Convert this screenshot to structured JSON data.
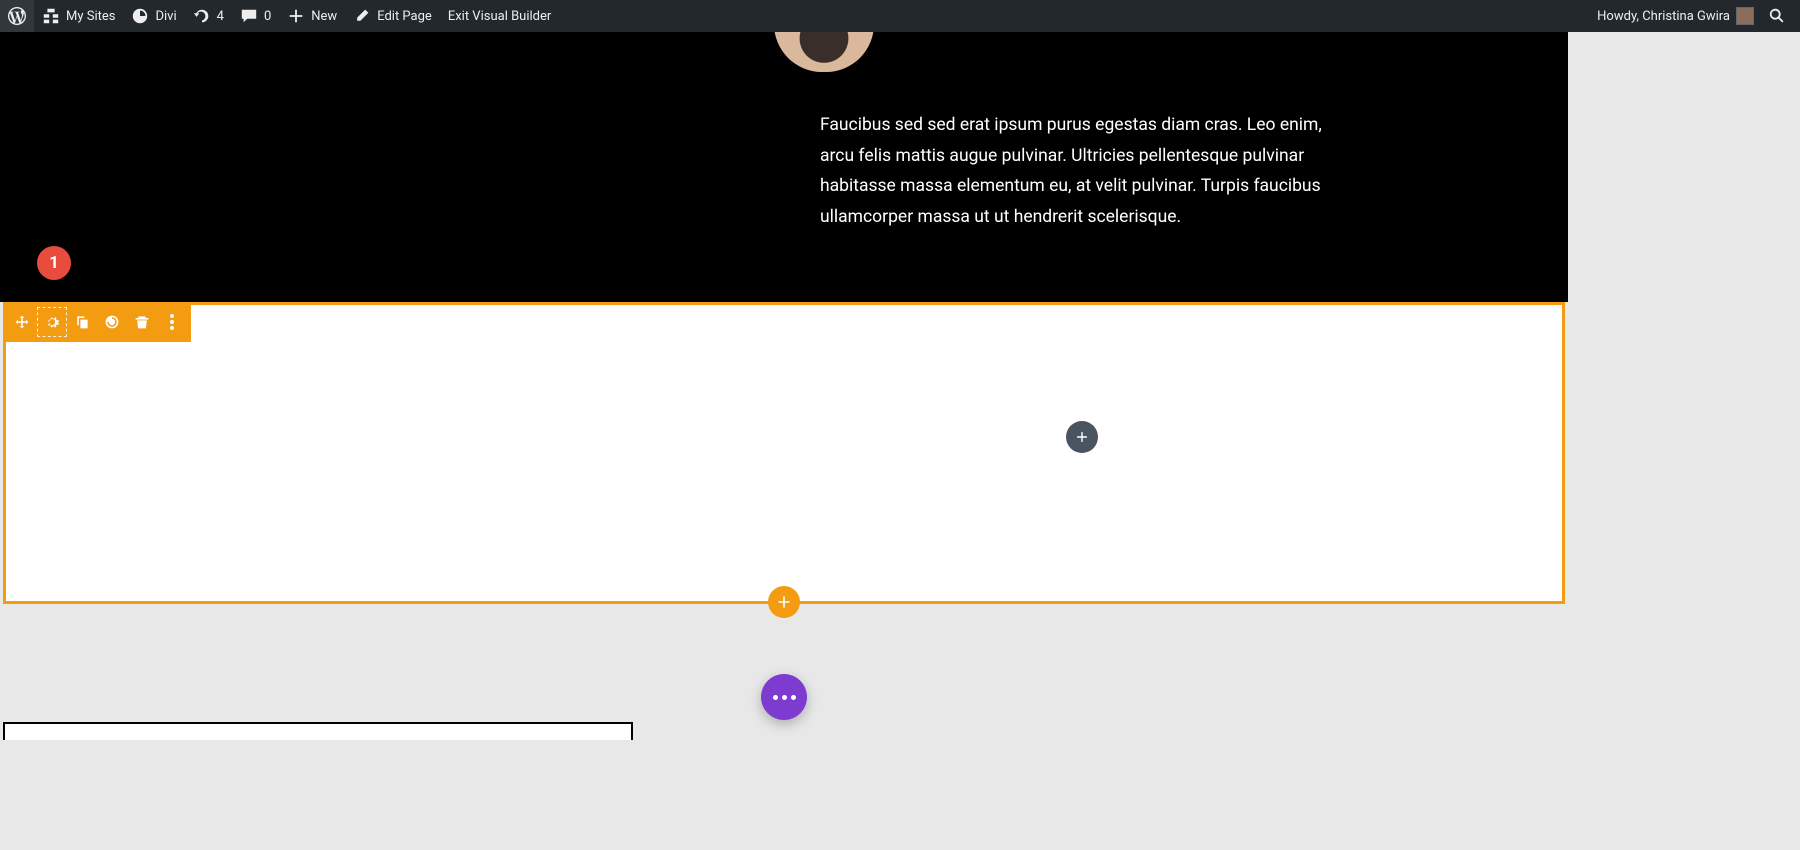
{
  "adminbar": {
    "my_sites": "My Sites",
    "site_name": "Divi",
    "updates_count": "4",
    "comments_count": "0",
    "new_label": "New",
    "edit_page": "Edit Page",
    "exit_vb": "Exit Visual Builder",
    "howdy": "Howdy, Christina Gwira"
  },
  "hero": {
    "body": "Faucibus sed sed erat ipsum purus egestas diam cras. Leo enim, arcu felis mattis augue pulvinar. Ultricies pellentesque pulvinar habitasse massa elementum eu, at velit pulvinar. Turpis faucibus ullamcorper massa ut ut hendrerit scelerisque."
  },
  "annotation": {
    "badge_1": "1"
  },
  "colors": {
    "accent_orange": "#f39c12",
    "accent_purple": "#7e3bd0",
    "badge_red": "#e74c3c"
  },
  "bottom": {
    "heading_partial": ""
  }
}
